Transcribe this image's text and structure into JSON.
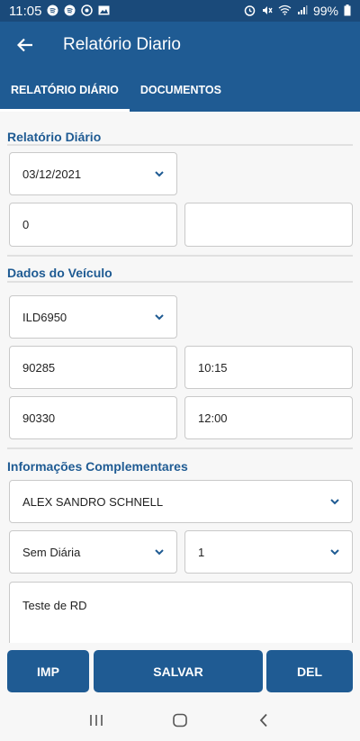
{
  "status_bar": {
    "time": "11:05",
    "battery": "99%",
    "left_icons": [
      "spotify-icon",
      "spotify-icon",
      "at-icon",
      "image-icon"
    ],
    "right_icons": [
      "alarm-icon",
      "mute-icon",
      "wifi-icon",
      "signal-icon",
      "battery-icon"
    ]
  },
  "app_bar": {
    "title": "Relatório Diario",
    "back_icon": "arrow-left-icon"
  },
  "tabs": [
    {
      "label": "RELATÓRIO DIÁRIO",
      "active": true
    },
    {
      "label": "DOCUMENTOS",
      "active": false
    }
  ],
  "sections": {
    "relatorio": {
      "title": "Relatório Diário",
      "date": "03/12/2021",
      "field_left": "0",
      "field_right": ""
    },
    "veiculo": {
      "title": "Dados do Veículo",
      "plate": "ILD6950",
      "km_start": "90285",
      "time_start": "10:15",
      "km_end": "90330",
      "time_end": "12:00"
    },
    "complementares": {
      "title": "Informações Complementares",
      "driver": "ALEX SANDRO SCHNELL",
      "diaria": "Sem Diária",
      "quantity": "1",
      "notes": "Teste de RD"
    }
  },
  "buttons": {
    "imp": "IMP",
    "salvar": "SALVAR",
    "del": "DEL"
  },
  "colors": {
    "primary": "#1f5b93",
    "status_bar": "#1a4a7a",
    "background": "#f7f7f7"
  }
}
